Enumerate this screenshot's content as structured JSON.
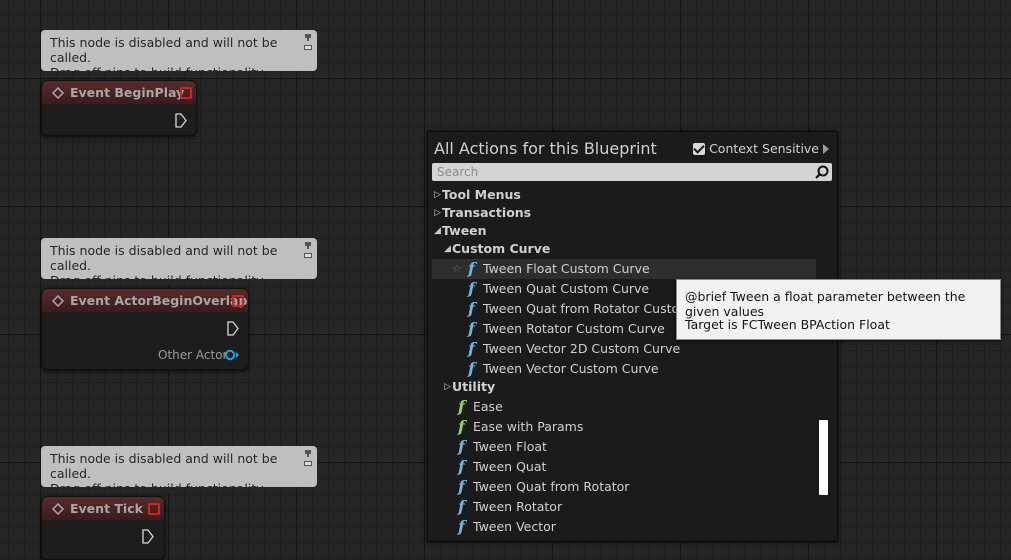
{
  "comments": [
    {
      "line1": "This node is disabled and will not be called.",
      "line2": "Drag off pins to build functionality."
    },
    {
      "line1": "This node is disabled and will not be called.",
      "line2": "Drag off pins to build functionality."
    },
    {
      "line1": "This node is disabled and will not be called.",
      "line2": "Drag off pins to build functionality."
    }
  ],
  "nodes": {
    "begin_play": {
      "title": "Event BeginPlay"
    },
    "actor_overlap": {
      "title": "Event ActorBeginOverlap",
      "pin_label": "Other Actor"
    },
    "tick": {
      "title": "Event Tick"
    }
  },
  "menu": {
    "title": "All Actions for this Blueprint",
    "context_sensitive_label": "Context Sensitive",
    "context_sensitive_checked": true,
    "search_placeholder": "Search",
    "rows": [
      {
        "label": "Tool Menus"
      },
      {
        "label": "Transactions"
      },
      {
        "label": "Tween"
      },
      {
        "label": "Custom Curve"
      },
      {
        "label": "Tween Float Custom Curve"
      },
      {
        "label": "Tween Quat Custom Curve"
      },
      {
        "label": "Tween Quat from Rotator Custom"
      },
      {
        "label": "Tween Rotator Custom Curve"
      },
      {
        "label": "Tween Vector 2D Custom Curve"
      },
      {
        "label": "Tween Vector Custom Curve"
      },
      {
        "label": "Utility"
      },
      {
        "label": "Ease"
      },
      {
        "label": "Ease with Params"
      },
      {
        "label": "Tween Float"
      },
      {
        "label": "Tween Quat"
      },
      {
        "label": "Tween Quat from Rotator"
      },
      {
        "label": "Tween Rotator"
      },
      {
        "label": "Tween Vector"
      }
    ]
  },
  "tooltip": {
    "line1": "@brief Tween a float parameter between the given values",
    "line2": "Target is FCTween BPAction Float"
  },
  "colors": {
    "function_blue": "#6fb6e6",
    "function_green": "#8fd46b",
    "event_red": "#c8262b",
    "object_pin": "#1ea2e8"
  },
  "icons": {
    "function": "function-icon",
    "event": "event-icon",
    "search": "search-icon",
    "pin": "pin-icon"
  }
}
